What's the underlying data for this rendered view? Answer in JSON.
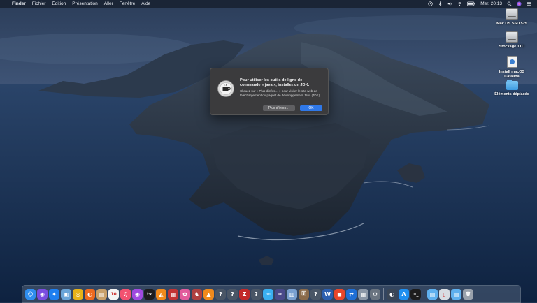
{
  "menubar": {
    "apple_glyph": "",
    "app_name": "Finder",
    "menus": [
      "Fichier",
      "Édition",
      "Présentation",
      "Aller",
      "Fenêtre",
      "Aide"
    ],
    "clock": "Mer. 20:13",
    "status_icons": [
      "time-machine-icon",
      "bluetooth-icon",
      "volume-icon",
      "wifi-icon",
      "battery-icon",
      "search-icon",
      "siri-icon",
      "control-icon"
    ]
  },
  "desktop_icons": [
    {
      "label": "Mac OS SSD 525",
      "type": "disk"
    },
    {
      "label": "Stockage 1TO",
      "type": "disk"
    },
    {
      "label": "Install macOS Catalina",
      "type": "installer"
    },
    {
      "label": "Éléments déplacés",
      "type": "folder"
    }
  ],
  "dialog": {
    "title": "Pour utiliser les outils de ligne de commande « java », installez un JDK.",
    "message": "Cliquez sur « Plus d'infos… » pour visiter le site web de téléchargement du paquet de développement Java (JDK).",
    "more_info_label": "Plus d'infos…",
    "ok_label": "OK",
    "icon": "java-coffee-icon"
  },
  "dock": {
    "apps": [
      {
        "name": "finder-icon",
        "color": "#2f8ef0",
        "glyph": "☺"
      },
      {
        "name": "siri-icon",
        "color": "#7a4de0",
        "glyph": "◉"
      },
      {
        "name": "safari-icon",
        "color": "#1e7ff0",
        "glyph": "✦"
      },
      {
        "name": "preview-icon",
        "color": "#6aa5d8",
        "glyph": "▣"
      },
      {
        "name": "chrome-icon",
        "color": "#e7b218",
        "glyph": "◎"
      },
      {
        "name": "firefox-icon",
        "color": "#ee6a1f",
        "glyph": "◐"
      },
      {
        "name": "notes-icon",
        "color": "#c8a06a",
        "glyph": "▤"
      },
      {
        "name": "calendar-icon",
        "color": "#f4f4f4",
        "glyph": "10"
      },
      {
        "name": "music-icon",
        "color": "#f25270",
        "glyph": "♫"
      },
      {
        "name": "podcasts-icon",
        "color": "#a04ae0",
        "glyph": "◉"
      },
      {
        "name": "apple-tv-icon",
        "color": "#1c1c1e",
        "glyph": "tv"
      },
      {
        "name": "vlc-icon",
        "color": "#f08a1c",
        "glyph": "◭"
      },
      {
        "name": "photo-booth-icon",
        "color": "#c23434",
        "glyph": "▦"
      },
      {
        "name": "photos-icon",
        "color": "#e25b9c",
        "glyph": "✿"
      },
      {
        "name": "chess-icon",
        "color": "#b04040",
        "glyph": "♞"
      },
      {
        "name": "vlc-cone-icon",
        "color": "#f08a1c",
        "glyph": "▲"
      },
      {
        "name": "unknown-app-icon",
        "color": "#4a5666",
        "glyph": "?"
      },
      {
        "name": "unknown-app-icon",
        "color": "#4a5666",
        "glyph": "?"
      },
      {
        "name": "filezilla-icon",
        "color": "#c22a2a",
        "glyph": "Z"
      },
      {
        "name": "unknown-app-icon",
        "color": "#4a5666",
        "glyph": "?"
      },
      {
        "name": "messages-icon",
        "color": "#3ab0f0",
        "glyph": "✉"
      },
      {
        "name": "final-cut-icon",
        "color": "#4a4a8a",
        "glyph": "✂"
      },
      {
        "name": "photo-editor-icon",
        "color": "#7aa0d0",
        "glyph": "▥"
      },
      {
        "name": "keychain-icon",
        "color": "#8a6a4a",
        "glyph": "⚿"
      },
      {
        "name": "unknown-app-icon",
        "color": "#4a5666",
        "glyph": "?"
      },
      {
        "name": "word-icon",
        "color": "#2b5fb0",
        "glyph": "W"
      },
      {
        "name": "keynote-icon",
        "color": "#e8462a",
        "glyph": "◼"
      },
      {
        "name": "teamviewer-icon",
        "color": "#1f6fd6",
        "glyph": "⇄"
      },
      {
        "name": "archive-icon",
        "color": "#8a96a6",
        "glyph": "▦"
      },
      {
        "name": "preferences-icon",
        "color": "#6a7480",
        "glyph": "⚙"
      }
    ],
    "right_apps": [
      {
        "name": "activity-monitor-icon",
        "color": "#3a4656",
        "glyph": "◐"
      },
      {
        "name": "app-store-icon",
        "color": "#1f8ff0",
        "glyph": "A"
      },
      {
        "name": "terminal-icon",
        "color": "#1d1d1d",
        "glyph": ">_"
      }
    ],
    "stack_items": [
      {
        "name": "applications-folder-icon",
        "color": "#5fb0ee",
        "glyph": "▤"
      },
      {
        "name": "document-icon",
        "color": "#d8dde3",
        "glyph": "▯"
      },
      {
        "name": "downloads-folder-icon",
        "color": "#5fb0ee",
        "glyph": "▤"
      },
      {
        "name": "trash-icon",
        "color": "#9aa2ac",
        "glyph": "🗑"
      }
    ]
  }
}
